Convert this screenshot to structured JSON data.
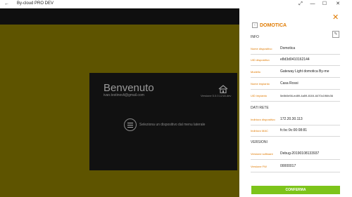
{
  "window": {
    "title": "By-cloud PRO DEV",
    "back_glyph": "←",
    "expand_glyph": "⤢",
    "minimize_glyph": "—",
    "maximize_glyph": "☐",
    "close_glyph": "✕"
  },
  "welcome": {
    "title": "Benvenuto",
    "email": "ivan.testinovli@gmail.com",
    "version": "Versione 5.0.0.1218-dev",
    "hint": "Seleziona un dispositivo dal menu laterale"
  },
  "panel": {
    "title": "DOMOTICA",
    "close_glyph": "✕",
    "back_glyph": "‹",
    "edit_glyph": "✎",
    "sections": {
      "info": "INFO",
      "network": "DATI RETE",
      "versions": "VERSIONI"
    },
    "info_rows": [
      {
        "label": "Nome dispositivo",
        "value": "Domotica"
      },
      {
        "label": "UID dispositivo",
        "value": "e8d3d0410162144"
      },
      {
        "label": "Modello",
        "value": "Gateway Light domotica By-me"
      },
      {
        "label": "Nome impianto",
        "value": "Casa Rossi"
      },
      {
        "label": "UID impianto",
        "value": "5e8b0e56-ed89-4a59-8104-6470c196fc36"
      }
    ],
    "network_rows": [
      {
        "label": "Indirizzo dispositivo",
        "value": "172.20.30.113"
      },
      {
        "label": "Indirizzo MAC",
        "value": "fc:bc:9c:00:08:81"
      }
    ],
    "version_rows": [
      {
        "label": "Versione software",
        "value": "Debug-20190108133937"
      },
      {
        "label": "Versione FW",
        "value": "00000017"
      }
    ],
    "confirm_label": "CONFERMA"
  },
  "colors": {
    "accent": "#e07a00",
    "confirm": "#7dc41a",
    "background": "#5e5400"
  }
}
